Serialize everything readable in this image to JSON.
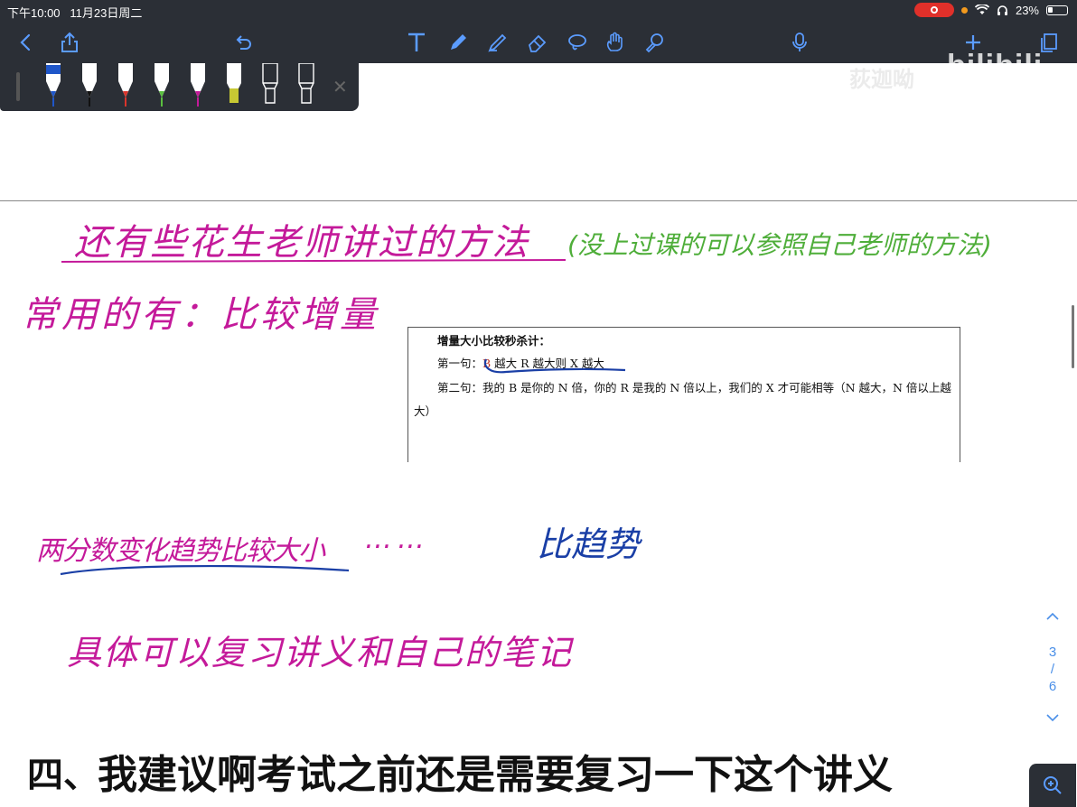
{
  "status": {
    "time": "下午10:00",
    "date": "11月23日周二",
    "battery": "23%"
  },
  "watermark": {
    "channel": "荻迦呦",
    "brand": "bilibili"
  },
  "toolbar": {
    "icons": [
      "back-chevron-icon",
      "share-icon",
      "undo-icon",
      "text-tool-icon",
      "pen-icon",
      "highlighter-icon",
      "eraser-icon",
      "lasso-icon",
      "hand-icon",
      "laser-icon",
      "microphone-icon",
      "add-page-icon",
      "pages-icon"
    ]
  },
  "pens": [
    {
      "name": "pen-blue",
      "color": "#1f56c9"
    },
    {
      "name": "pen-black",
      "color": "#111111"
    },
    {
      "name": "pen-red",
      "color": "#d9342b"
    },
    {
      "name": "pen-green",
      "color": "#5abf3f"
    },
    {
      "name": "pen-magenta",
      "color": "#c41a9a"
    },
    {
      "name": "highlighter-yellow",
      "color": "#c7c833"
    },
    {
      "name": "pen-empty-1",
      "color": "#2b2f36"
    },
    {
      "name": "pen-empty-2",
      "color": "#2b2f36"
    }
  ],
  "document": {
    "title": "增量大小比较秒杀计：",
    "line1_prefix": "第一句：",
    "line1_b": "B",
    "line1_rest": " 越大 R 越大则 X 越大",
    "line2": "第二句：我的 B 是你的 N 倍，你的 R 是我的 N 倍以上，我们的 X 才可能相等（N 越大，N 倍以上越",
    "line3": "大）"
  },
  "handwriting": {
    "heading": "还有些花生老师讲过的方法",
    "heading_note": "(没上过课的可以参照自己老师的方法)",
    "common": "常用的有：比较增量",
    "trend": "两分数变化趋势比较大小",
    "dots": "……",
    "trend_note": "比趋势",
    "review": "具体可以复习讲义和自己的笔记",
    "section_partial": "四、"
  },
  "subtitle": "我建议啊考试之前还是需要复习一下这个讲义",
  "pager": {
    "current": "3",
    "sep": "/",
    "total": "6"
  }
}
